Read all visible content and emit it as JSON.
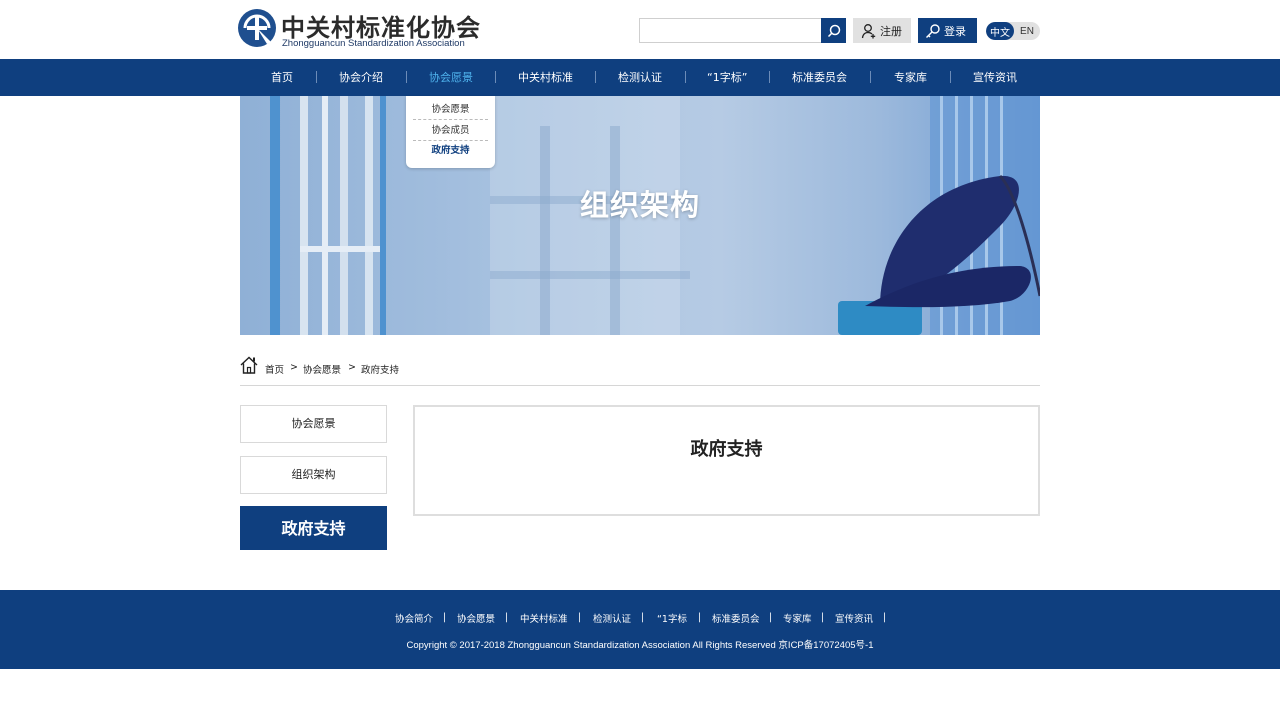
{
  "header": {
    "logo_cn": "中关村标准化协会",
    "logo_en": "Zhongguancun Standardization Association",
    "search": {
      "placeholder": "",
      "value": ""
    },
    "register_label": "注册",
    "login_label": "登录",
    "lang_cn": "中文",
    "lang_en": "EN"
  },
  "nav": {
    "items": [
      {
        "label": "首页"
      },
      {
        "label": "协会介绍"
      },
      {
        "label": "协会愿景"
      },
      {
        "label": "中关村标准"
      },
      {
        "label": "检测认证"
      },
      {
        "label": "“1字标”"
      },
      {
        "label": "标准委员会"
      },
      {
        "label": "专家库"
      },
      {
        "label": "宣传资讯"
      }
    ],
    "active": "协会愿景"
  },
  "dropdown": {
    "items": [
      "协会愿景",
      "协会成员",
      "政府支持"
    ],
    "active": "政府支持"
  },
  "banner": {
    "title": "组织架构"
  },
  "breadcrumb": {
    "items": [
      "首页",
      "协会愿景",
      "政府支持"
    ],
    "separator": ">"
  },
  "side_menu": {
    "items": [
      "协会愿景",
      "组织架构",
      "政府支持"
    ],
    "active": "政府支持"
  },
  "content": {
    "title": "政府支持"
  },
  "footer": {
    "links": [
      "协会简介",
      "协会愿景",
      "中关村标准",
      "检测认证",
      "“1字标",
      "标准委员会",
      "专家库",
      "宣传资讯"
    ],
    "separator": "|",
    "copyright": "Copyright © 2017-2018 Zhongguancun Standardization Association All Rights Reserved 京ICP备17072405号-1"
  },
  "colors": {
    "primary": "#0f3f7f",
    "nav_active": "#4fb3ee",
    "border": "#d9d9d9"
  },
  "icons": [
    "logo-mark-icon",
    "search-icon",
    "user-icon",
    "key-icon",
    "home-icon"
  ]
}
